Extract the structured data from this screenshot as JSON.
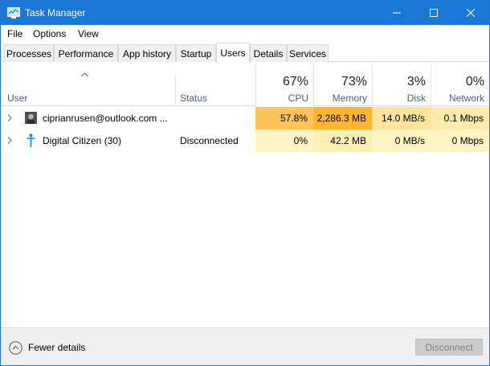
{
  "window": {
    "title": "Task Manager",
    "accent": "#1a78d6"
  },
  "menu": [
    "File",
    "Options",
    "View"
  ],
  "tabs": [
    "Processes",
    "Performance",
    "App history",
    "Startup",
    "Users",
    "Details",
    "Services"
  ],
  "active_tab": "Users",
  "columns": {
    "user": "User",
    "status": "Status",
    "cpu": {
      "percent": "67%",
      "label": "CPU"
    },
    "memory": {
      "percent": "73%",
      "label": "Memory"
    },
    "disk": {
      "percent": "3%",
      "label": "Disk"
    },
    "network": {
      "percent": "0%",
      "label": "Network"
    }
  },
  "rows": [
    {
      "user": "ciprianrusen@outlook.com ...",
      "status": "",
      "cpu": "57.8%",
      "memory": "2,286.3 MB",
      "disk": "14.0 MB/s",
      "network": "0.1 Mbps",
      "colors": {
        "cpu": "#fdc45a",
        "memory": "#fbb531",
        "disk": "#fde49c",
        "network": "#fde9a9"
      }
    },
    {
      "user": "Digital Citizen (30)",
      "status": "Disconnected",
      "cpu": "0%",
      "memory": "42.2 MB",
      "disk": "0 MB/s",
      "network": "0 Mbps",
      "colors": {
        "cpu": "#fff4c4",
        "memory": "#feefb4",
        "disk": "#fff4c4",
        "network": "#fff4c4"
      }
    }
  ],
  "footer": {
    "fewer_details": "Fewer details",
    "disconnect": "Disconnect"
  },
  "icons": {
    "app": "task-manager-icon",
    "expand": "chevron-right-icon",
    "sort": "sort-up-icon",
    "fewer": "chevron-up-circle-icon"
  }
}
